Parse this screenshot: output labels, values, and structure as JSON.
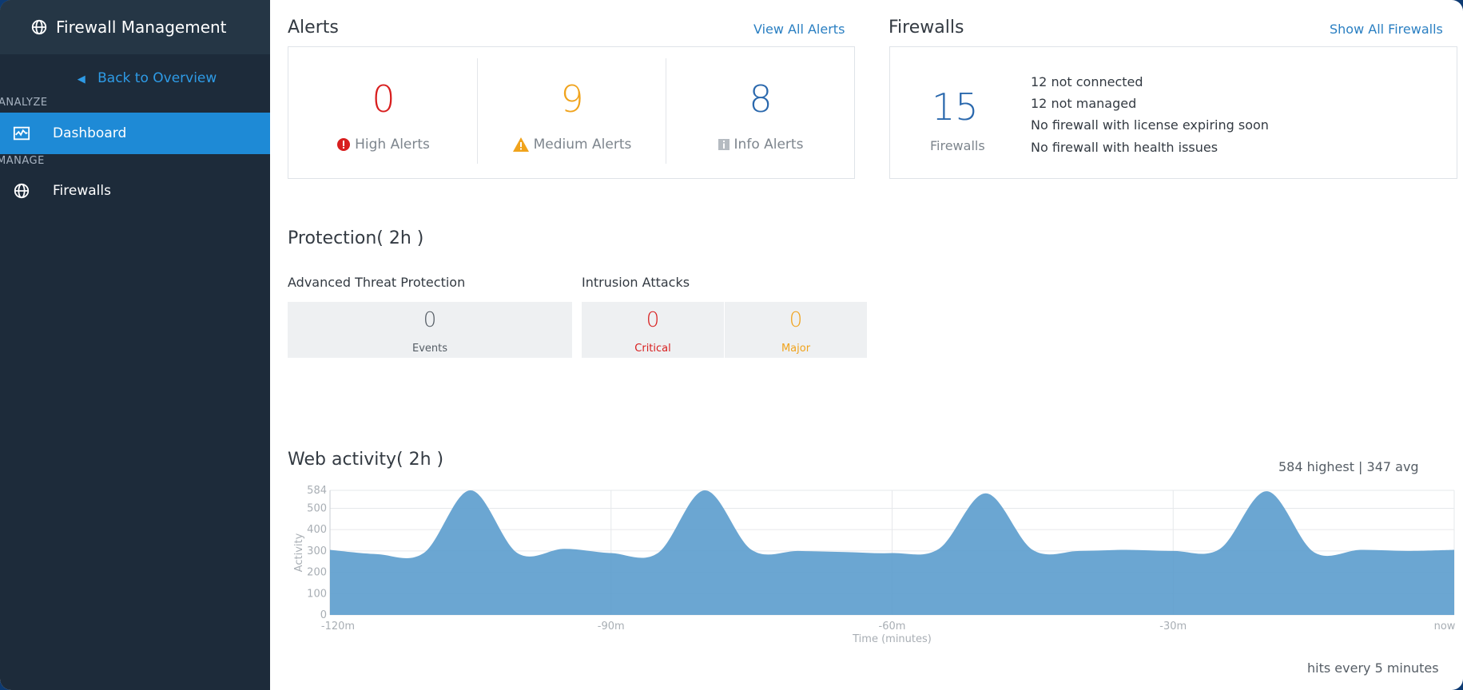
{
  "sidebar": {
    "title": "Firewall Management",
    "back_link": "Back to Overview",
    "section_analyze": "ANALYZE",
    "section_manage": "MANAGE",
    "items": [
      {
        "label": "Dashboard",
        "icon": "activity-icon",
        "active": true
      },
      {
        "label": "Firewalls",
        "icon": "globe-icon",
        "active": false
      }
    ]
  },
  "alerts": {
    "title": "Alerts",
    "view_all": "View All Alerts",
    "high": {
      "value": "0",
      "label": "High Alerts",
      "color": "#d81e1e"
    },
    "medium": {
      "value": "9",
      "label": "Medium Alerts",
      "color": "#f0a31c"
    },
    "info": {
      "value": "8",
      "label": "Info Alerts",
      "color": "#2a68ad"
    }
  },
  "firewalls": {
    "title": "Firewalls",
    "show_all": "Show All Firewalls",
    "count": "15",
    "count_label": "Firewalls",
    "status_lines": [
      "12 not connected",
      "12 not managed",
      "No firewall with license expiring soon",
      "No firewall with health issues"
    ]
  },
  "protection": {
    "title": "Protection( 2h )",
    "atp": {
      "title": "Advanced Threat Protection",
      "value": "0",
      "label": "Events"
    },
    "intrusion": {
      "title": "Intrusion Attacks",
      "critical": {
        "value": "0",
        "label": "Critical",
        "color": "#d81e1e"
      },
      "major": {
        "value": "0",
        "label": "Major",
        "color": "#f0a31c"
      }
    }
  },
  "web_activity": {
    "title": "Web activity( 2h )",
    "summary": "584 highest | 347 avg",
    "footer": "hits every 5 minutes"
  },
  "chart_data": {
    "type": "area",
    "ylabel": "Activity",
    "xlabel": "Time (minutes)",
    "ylim": [
      0,
      584
    ],
    "xlim": [
      -120,
      0
    ],
    "y_ticks": [
      "0",
      "100",
      "200",
      "300",
      "400",
      "500",
      "584"
    ],
    "x_ticks": [
      {
        "value": -120,
        "label": "-120m"
      },
      {
        "value": -90,
        "label": "-90m"
      },
      {
        "value": -60,
        "label": "-60m"
      },
      {
        "value": -30,
        "label": "-30m"
      },
      {
        "value": 0,
        "label": "now"
      }
    ],
    "grid": true,
    "color": "#5b9ccd",
    "x": [
      -120,
      -115,
      -110,
      -105,
      -100,
      -95,
      -90,
      -85,
      -80,
      -75,
      -70,
      -65,
      -60,
      -55,
      -50,
      -45,
      -40,
      -35,
      -30,
      -25,
      -20,
      -15,
      -10,
      -5,
      0
    ],
    "values": [
      305,
      285,
      290,
      584,
      290,
      310,
      290,
      290,
      584,
      305,
      300,
      295,
      290,
      310,
      570,
      305,
      300,
      305,
      300,
      310,
      580,
      295,
      305,
      300,
      305
    ]
  }
}
